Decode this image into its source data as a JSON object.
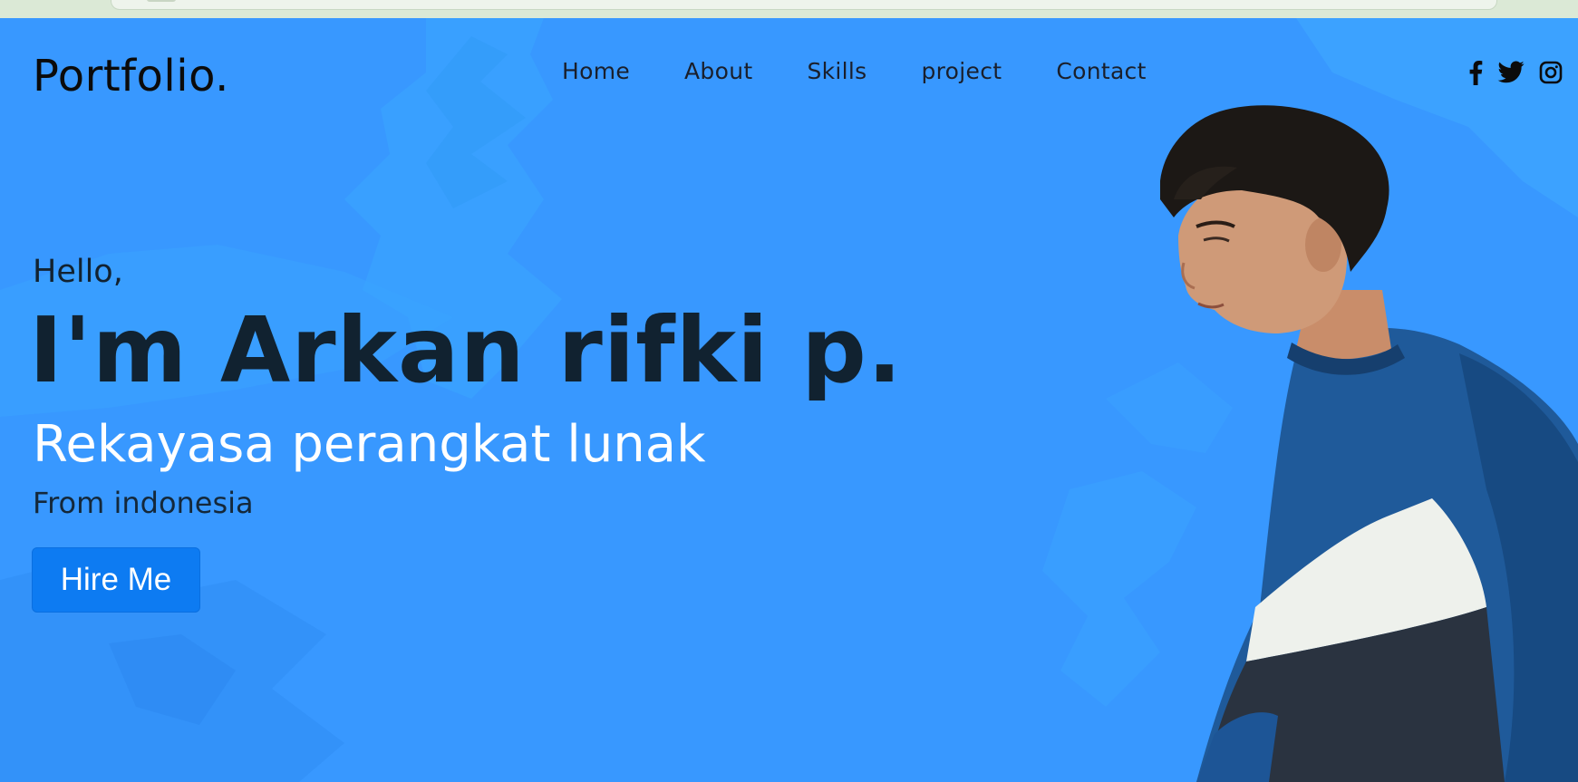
{
  "nav": {
    "logo": "Portfolio.",
    "links": [
      "Home",
      "About",
      "Skills",
      "project",
      "Contact"
    ]
  },
  "socials": [
    "facebook-icon",
    "twitter-icon",
    "instagram-icon"
  ],
  "hero": {
    "greeting": "Hello,",
    "name": "I'm Arkan rifki p.",
    "role": "Rekayasa perangkat lunak",
    "origin": "From indonesia",
    "cta_label": "Hire Me"
  },
  "colors": {
    "background": "#3899ff",
    "button": "#0d7bf2",
    "dark_text": "#112230",
    "role_text": "#ffffff"
  }
}
